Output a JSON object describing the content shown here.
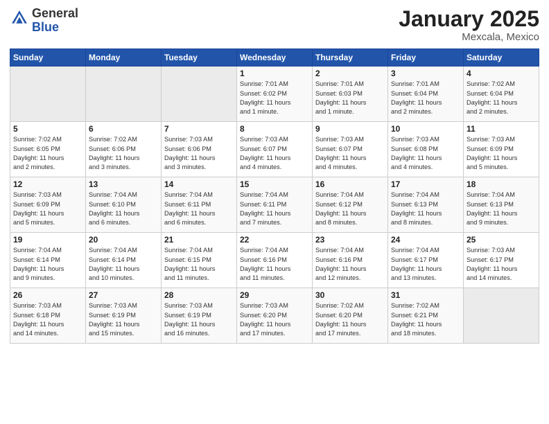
{
  "header": {
    "logo_general": "General",
    "logo_blue": "Blue",
    "title": "January 2025",
    "subtitle": "Mexcala, Mexico"
  },
  "days_of_week": [
    "Sunday",
    "Monday",
    "Tuesday",
    "Wednesday",
    "Thursday",
    "Friday",
    "Saturday"
  ],
  "weeks": [
    [
      {
        "day": "",
        "info": ""
      },
      {
        "day": "",
        "info": ""
      },
      {
        "day": "",
        "info": ""
      },
      {
        "day": "1",
        "info": "Sunrise: 7:01 AM\nSunset: 6:02 PM\nDaylight: 11 hours\nand 1 minute."
      },
      {
        "day": "2",
        "info": "Sunrise: 7:01 AM\nSunset: 6:03 PM\nDaylight: 11 hours\nand 1 minute."
      },
      {
        "day": "3",
        "info": "Sunrise: 7:01 AM\nSunset: 6:04 PM\nDaylight: 11 hours\nand 2 minutes."
      },
      {
        "day": "4",
        "info": "Sunrise: 7:02 AM\nSunset: 6:04 PM\nDaylight: 11 hours\nand 2 minutes."
      }
    ],
    [
      {
        "day": "5",
        "info": "Sunrise: 7:02 AM\nSunset: 6:05 PM\nDaylight: 11 hours\nand 2 minutes."
      },
      {
        "day": "6",
        "info": "Sunrise: 7:02 AM\nSunset: 6:06 PM\nDaylight: 11 hours\nand 3 minutes."
      },
      {
        "day": "7",
        "info": "Sunrise: 7:03 AM\nSunset: 6:06 PM\nDaylight: 11 hours\nand 3 minutes."
      },
      {
        "day": "8",
        "info": "Sunrise: 7:03 AM\nSunset: 6:07 PM\nDaylight: 11 hours\nand 4 minutes."
      },
      {
        "day": "9",
        "info": "Sunrise: 7:03 AM\nSunset: 6:07 PM\nDaylight: 11 hours\nand 4 minutes."
      },
      {
        "day": "10",
        "info": "Sunrise: 7:03 AM\nSunset: 6:08 PM\nDaylight: 11 hours\nand 4 minutes."
      },
      {
        "day": "11",
        "info": "Sunrise: 7:03 AM\nSunset: 6:09 PM\nDaylight: 11 hours\nand 5 minutes."
      }
    ],
    [
      {
        "day": "12",
        "info": "Sunrise: 7:03 AM\nSunset: 6:09 PM\nDaylight: 11 hours\nand 5 minutes."
      },
      {
        "day": "13",
        "info": "Sunrise: 7:04 AM\nSunset: 6:10 PM\nDaylight: 11 hours\nand 6 minutes."
      },
      {
        "day": "14",
        "info": "Sunrise: 7:04 AM\nSunset: 6:11 PM\nDaylight: 11 hours\nand 6 minutes."
      },
      {
        "day": "15",
        "info": "Sunrise: 7:04 AM\nSunset: 6:11 PM\nDaylight: 11 hours\nand 7 minutes."
      },
      {
        "day": "16",
        "info": "Sunrise: 7:04 AM\nSunset: 6:12 PM\nDaylight: 11 hours\nand 8 minutes."
      },
      {
        "day": "17",
        "info": "Sunrise: 7:04 AM\nSunset: 6:13 PM\nDaylight: 11 hours\nand 8 minutes."
      },
      {
        "day": "18",
        "info": "Sunrise: 7:04 AM\nSunset: 6:13 PM\nDaylight: 11 hours\nand 9 minutes."
      }
    ],
    [
      {
        "day": "19",
        "info": "Sunrise: 7:04 AM\nSunset: 6:14 PM\nDaylight: 11 hours\nand 9 minutes."
      },
      {
        "day": "20",
        "info": "Sunrise: 7:04 AM\nSunset: 6:14 PM\nDaylight: 11 hours\nand 10 minutes."
      },
      {
        "day": "21",
        "info": "Sunrise: 7:04 AM\nSunset: 6:15 PM\nDaylight: 11 hours\nand 11 minutes."
      },
      {
        "day": "22",
        "info": "Sunrise: 7:04 AM\nSunset: 6:16 PM\nDaylight: 11 hours\nand 11 minutes."
      },
      {
        "day": "23",
        "info": "Sunrise: 7:04 AM\nSunset: 6:16 PM\nDaylight: 11 hours\nand 12 minutes."
      },
      {
        "day": "24",
        "info": "Sunrise: 7:04 AM\nSunset: 6:17 PM\nDaylight: 11 hours\nand 13 minutes."
      },
      {
        "day": "25",
        "info": "Sunrise: 7:03 AM\nSunset: 6:17 PM\nDaylight: 11 hours\nand 14 minutes."
      }
    ],
    [
      {
        "day": "26",
        "info": "Sunrise: 7:03 AM\nSunset: 6:18 PM\nDaylight: 11 hours\nand 14 minutes."
      },
      {
        "day": "27",
        "info": "Sunrise: 7:03 AM\nSunset: 6:19 PM\nDaylight: 11 hours\nand 15 minutes."
      },
      {
        "day": "28",
        "info": "Sunrise: 7:03 AM\nSunset: 6:19 PM\nDaylight: 11 hours\nand 16 minutes."
      },
      {
        "day": "29",
        "info": "Sunrise: 7:03 AM\nSunset: 6:20 PM\nDaylight: 11 hours\nand 17 minutes."
      },
      {
        "day": "30",
        "info": "Sunrise: 7:02 AM\nSunset: 6:20 PM\nDaylight: 11 hours\nand 17 minutes."
      },
      {
        "day": "31",
        "info": "Sunrise: 7:02 AM\nSunset: 6:21 PM\nDaylight: 11 hours\nand 18 minutes."
      },
      {
        "day": "",
        "info": ""
      }
    ]
  ]
}
